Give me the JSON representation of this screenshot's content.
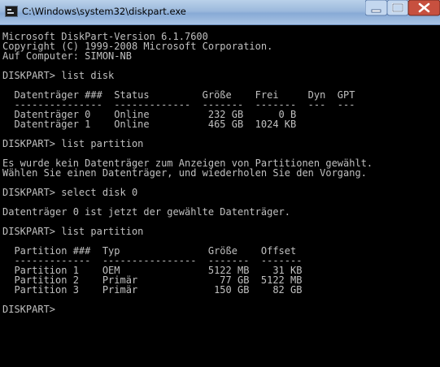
{
  "window": {
    "title": "C:\\Windows\\system32\\diskpart.exe"
  },
  "console": {
    "lines": [
      "Microsoft DiskPart-Version 6.1.7600",
      "Copyright (C) 1999-2008 Microsoft Corporation.",
      "Auf Computer: SIMON-NB",
      "",
      "DISKPART> list disk",
      "",
      "  Datenträger ###  Status         Größe    Frei     Dyn  GPT",
      "  ---------------  -------------  -------  -------  ---  ---",
      "  Datenträger 0    Online          232 GB      0 B",
      "  Datenträger 1    Online          465 GB  1024 KB",
      "",
      "DISKPART> list partition",
      "",
      "Es wurde kein Datenträger zum Anzeigen von Partitionen gewählt.",
      "Wählen Sie einen Datenträger, und wiederholen Sie den Vorgang.",
      "",
      "DISKPART> select disk 0",
      "",
      "Datenträger 0 ist jetzt der gewählte Datenträger.",
      "",
      "DISKPART> list partition",
      "",
      "  Partition ###  Typ               Größe    Offset",
      "  -------------  ----------------  -------  -------",
      "  Partition 1    OEM               5122 MB    31 KB",
      "  Partition 2    Primär              77 GB  5122 MB",
      "  Partition 3    Primär             150 GB    82 GB",
      "",
      "DISKPART> "
    ]
  }
}
